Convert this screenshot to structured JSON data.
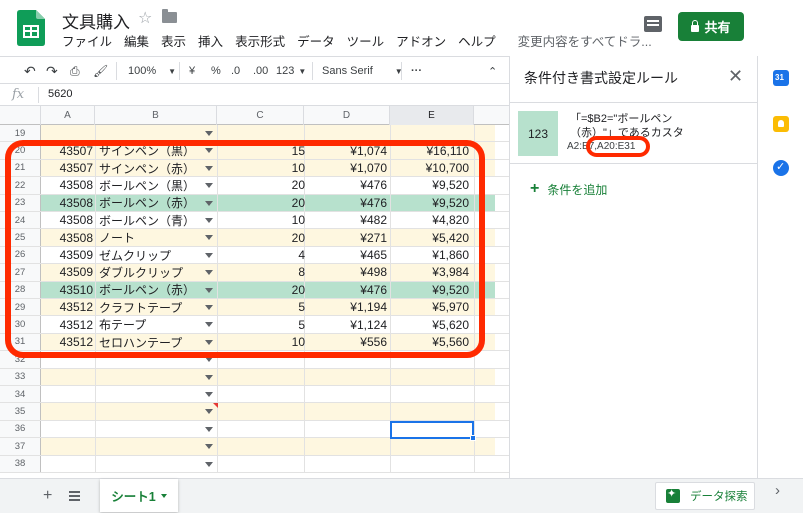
{
  "header": {
    "title": "文具購入",
    "menu": [
      "ファイル",
      "編集",
      "表示",
      "挿入",
      "表示形式",
      "データ",
      "ツール",
      "アドオン",
      "ヘルプ",
      "変更内容をすべてドラ..."
    ],
    "share_label": "共有"
  },
  "toolbar": {
    "zoom": "100%",
    "currency": "¥",
    "percent": "%",
    "decimal_less": ".0",
    "decimal_more": ".00",
    "number_format": "123",
    "font": "Sans Serif",
    "more": "···"
  },
  "formula_bar": {
    "fx": "fx",
    "value": "5620"
  },
  "columns": [
    "A",
    "B",
    "C",
    "D",
    "E"
  ],
  "rows": [
    {
      "n": "19",
      "a": "",
      "b": "",
      "c": "",
      "d": "",
      "e": "",
      "bg": "cream"
    },
    {
      "n": "20",
      "a": "43507",
      "b": "サインペン（黒）",
      "c": "15",
      "d": "¥1,074",
      "e": "¥16,110",
      "bg": "cream"
    },
    {
      "n": "21",
      "a": "43507",
      "b": "サインペン（赤）",
      "c": "10",
      "d": "¥1,070",
      "e": "¥10,700",
      "bg": "cream"
    },
    {
      "n": "22",
      "a": "43508",
      "b": "ボールペン（黒）",
      "c": "20",
      "d": "¥476",
      "e": "¥9,520",
      "bg": "white"
    },
    {
      "n": "23",
      "a": "43508",
      "b": "ボールペン（赤）",
      "c": "20",
      "d": "¥476",
      "e": "¥9,520",
      "bg": "green"
    },
    {
      "n": "24",
      "a": "43508",
      "b": "ボールペン（青）",
      "c": "10",
      "d": "¥482",
      "e": "¥4,820",
      "bg": "white"
    },
    {
      "n": "25",
      "a": "43508",
      "b": "ノート",
      "c": "20",
      "d": "¥271",
      "e": "¥5,420",
      "bg": "cream"
    },
    {
      "n": "26",
      "a": "43509",
      "b": "ゼムクリップ",
      "c": "4",
      "d": "¥465",
      "e": "¥1,860",
      "bg": "white"
    },
    {
      "n": "27",
      "a": "43509",
      "b": "ダブルクリップ",
      "c": "8",
      "d": "¥498",
      "e": "¥3,984",
      "bg": "cream"
    },
    {
      "n": "28",
      "a": "43510",
      "b": "ボールペン（赤）",
      "c": "20",
      "d": "¥476",
      "e": "¥9,520",
      "bg": "green"
    },
    {
      "n": "29",
      "a": "43512",
      "b": "クラフトテープ",
      "c": "5",
      "d": "¥1,194",
      "e": "¥5,970",
      "bg": "cream"
    },
    {
      "n": "30",
      "a": "43512",
      "b": "布テープ",
      "c": "5",
      "d": "¥1,124",
      "e": "¥5,620",
      "bg": "white"
    },
    {
      "n": "31",
      "a": "43512",
      "b": "セロハンテープ",
      "c": "10",
      "d": "¥556",
      "e": "¥5,560",
      "bg": "cream"
    },
    {
      "n": "32",
      "a": "",
      "b": "",
      "c": "",
      "d": "",
      "e": "",
      "bg": "white"
    },
    {
      "n": "33",
      "a": "",
      "b": "",
      "c": "",
      "d": "",
      "e": "",
      "bg": "cream"
    },
    {
      "n": "34",
      "a": "",
      "b": "",
      "c": "",
      "d": "",
      "e": "",
      "bg": "white"
    },
    {
      "n": "35",
      "a": "",
      "b": "",
      "c": "",
      "d": "",
      "e": "",
      "bg": "cream"
    },
    {
      "n": "36",
      "a": "",
      "b": "",
      "c": "",
      "d": "",
      "e": "",
      "bg": "white"
    },
    {
      "n": "37",
      "a": "",
      "b": "",
      "c": "",
      "d": "",
      "e": "",
      "bg": "cream"
    },
    {
      "n": "38",
      "a": "",
      "b": "",
      "c": "",
      "d": "",
      "e": "",
      "bg": "white"
    }
  ],
  "side_panel": {
    "title": "条件付き書式設定ルール",
    "rule_preview": "123",
    "rule_line1": "「=$B2=\"ボールペン",
    "rule_line2": "（赤）\"」であるカスタ",
    "rule_range_a": "A2:E",
    "rule_range_b": "7,A20:E31",
    "add_rule_label": "条件を追加"
  },
  "sheet_bar": {
    "tab_label": "シート1",
    "explore_label": "データ探索"
  },
  "colors": {
    "accent": "#188038",
    "highlight_green": "#b7e1cd",
    "highlight_cream": "#fef7e0",
    "annotation_red": "#ff2a00"
  }
}
